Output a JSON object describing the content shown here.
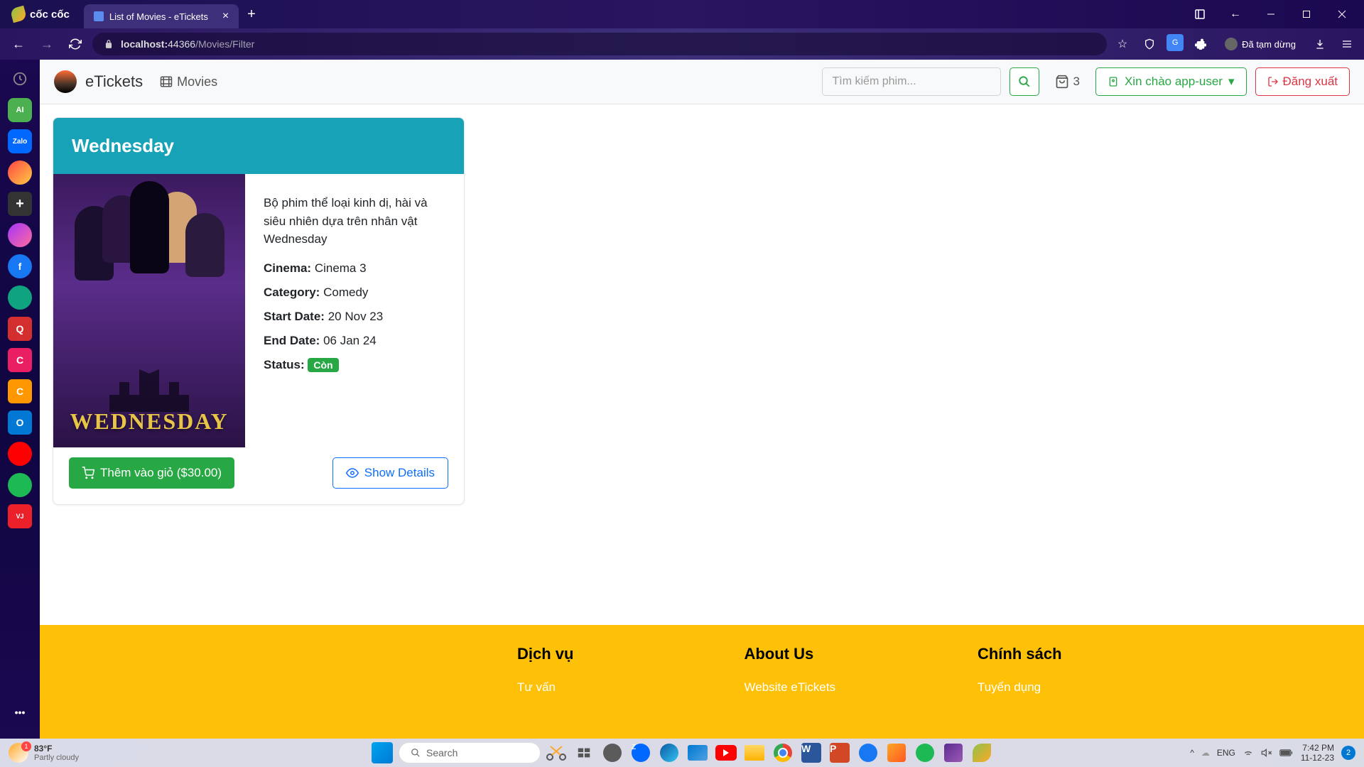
{
  "browser": {
    "brand": "cốc cốc",
    "tab_title": "List of Movies - eTickets",
    "url_host": "localhost:",
    "url_port": "44366",
    "url_path": "/Movies/Filter",
    "paused_label": "Đã tạm dừng"
  },
  "nav": {
    "brand": "eTickets",
    "movies_label": "Movies",
    "search_placeholder": "Tìm kiếm phim...",
    "cart_count": "3",
    "user_greeting": "Xin chào app-user",
    "logout_label": "Đăng xuất"
  },
  "movie": {
    "title": "Wednesday",
    "poster_text": "WEDNESDAY",
    "description": "Bộ phim thể loại kinh dị, hài và siêu nhiên dựa trên nhân vật Wednesday",
    "cinema_label": "Cinema:",
    "cinema_value": "Cinema 3",
    "category_label": "Category:",
    "category_value": "Comedy",
    "start_label": "Start Date:",
    "start_value": "20 Nov 23",
    "end_label": "End Date:",
    "end_value": "06 Jan 24",
    "status_label": "Status:",
    "status_badge": "Còn",
    "add_cart_label": "Thêm vào giỏ ($30.00)",
    "show_details_label": "Show Details"
  },
  "footer": {
    "col1_title": "Dịch vụ",
    "col1_link": "Tư vấn",
    "col2_title": "About Us",
    "col2_link": "Website eTickets",
    "col3_title": "Chính sách",
    "col3_link": "Tuyển dụng"
  },
  "taskbar": {
    "temp": "83°F",
    "weather": "Partly cloudy",
    "search_placeholder": "Search",
    "lang": "ENG",
    "time": "7:42 PM",
    "date": "11-12-23",
    "notif_count": "2",
    "weather_badge": "1"
  }
}
